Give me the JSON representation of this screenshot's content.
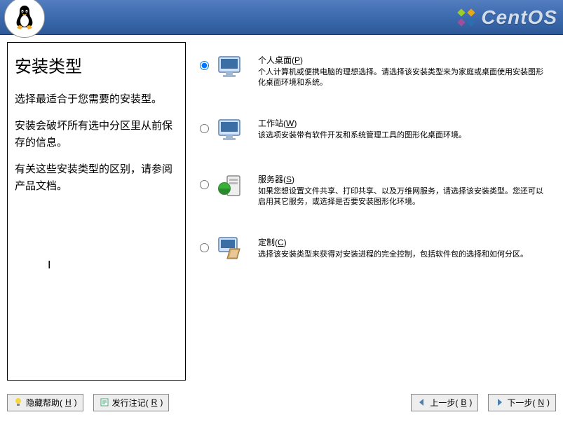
{
  "brand": "CentOS",
  "sidebar": {
    "title": "安装类型",
    "para1": "选择最适合于您需要的安装型。",
    "para2": "安装会破坏所有选中分区里从前保存的信息。",
    "para3": "有关这些安装类型的区别，请参阅产品文档。"
  },
  "options": [
    {
      "title_pre": "个人桌面(",
      "mnemonic": "P",
      "title_post": ")",
      "desc": "个人计算机或便携电脑的理想选择。请选择该安装类型来为家庭或桌面使用安装图形化桌面环境和系统。",
      "selected": true
    },
    {
      "title_pre": "工作站(",
      "mnemonic": "W",
      "title_post": ")",
      "desc": "该选项安装带有软件开发和系统管理工具的图形化桌面环境。",
      "selected": false
    },
    {
      "title_pre": "服务器(",
      "mnemonic": "S",
      "title_post": ")",
      "desc": "如果您想设置文件共享、打印共享、以及万维网服务，请选择该安装类型。您还可以启用其它服务，或选择是否要安装图形化环境。",
      "selected": false
    },
    {
      "title_pre": "定制(",
      "mnemonic": "C",
      "title_post": ")",
      "desc": "选择该安装类型来获得对安装进程的完全控制，包括软件包的选择和如何分区。",
      "selected": false
    }
  ],
  "buttons": {
    "hide_help": "隐藏帮助(",
    "hide_help_m": "H",
    "hide_help_post": ")",
    "release_notes": "发行注记(",
    "release_notes_m": "R",
    "release_notes_post": ")",
    "back": "上一步(",
    "back_m": "B",
    "back_post": ")",
    "next": "下一步(",
    "next_m": "N",
    "next_post": ")"
  }
}
